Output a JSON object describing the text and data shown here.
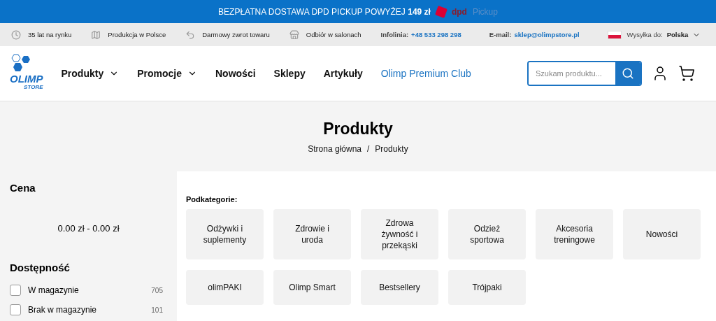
{
  "promo_banner": {
    "text": "BEZPŁATNA DOSTAWA DPD PICKUP POWYŻEJ **149 zł**",
    "brand": "dpd",
    "brand_suffix": "Pickup"
  },
  "info_bar": {
    "items": [
      "35 lat na rynku",
      "Produkcja w Polsce",
      "Darmowy zwrot towaru",
      "Odbiór w salonach"
    ],
    "hotline": {
      "label": "Infolinia:",
      "value": "+48 533 298 298"
    },
    "email": {
      "label": "E-mail:",
      "value": "sklep@olimpstore.pl"
    },
    "shipping": {
      "label": "Wysyłka do:",
      "value": "Polska"
    }
  },
  "header": {
    "logo": {
      "text": "OLIMP",
      "subtext": "STORE"
    },
    "nav": [
      {
        "label": "Produkty",
        "dropdown": true,
        "highlight": false
      },
      {
        "label": "Promocje",
        "dropdown": true,
        "highlight": false
      },
      {
        "label": "Nowości",
        "dropdown": false,
        "highlight": false
      },
      {
        "label": "Sklepy",
        "dropdown": false,
        "highlight": false
      },
      {
        "label": "Artykuły",
        "dropdown": false,
        "highlight": false
      },
      {
        "label": "Olimp Premium Club",
        "dropdown": false,
        "highlight": true
      }
    ],
    "search": {
      "placeholder": "Szukam produktu..."
    }
  },
  "page": {
    "title": "Produkty",
    "breadcrumb": [
      "Strona główna",
      "Produkty"
    ],
    "breadcrumb_separator": "/"
  },
  "sidebar": {
    "price": {
      "title": "Cena",
      "range": "0.00 zł - 0.00 zł"
    },
    "availability": {
      "title": "Dostępność",
      "options": [
        {
          "label": "W magazynie",
          "count": "705",
          "checked": false
        },
        {
          "label": "Brak w magazynie",
          "count": "101",
          "checked": false
        }
      ]
    }
  },
  "subcategories": {
    "title": "Podkategorie:",
    "items": [
      "Odżywki i suplementy",
      "Zdrowie i uroda",
      "Zdrowa żywność i przekąski",
      "Odzież sportowa",
      "Akcesoria treningowe",
      "Nowości",
      "olimPAKI",
      "Olimp Smart",
      "Bestsellery",
      "Trójpaki"
    ]
  }
}
